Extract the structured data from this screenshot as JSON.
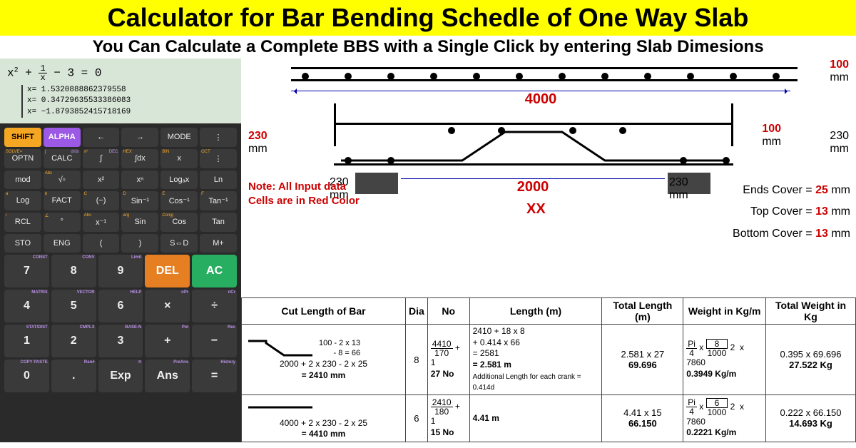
{
  "title": "Calculator for Bar Bending Schedle of One Way Slab",
  "subtitle": "You Can Calculate a Complete BBS with a Single Click by entering Slab Dimesions",
  "calculator": {
    "equation_html": "x<sup>2</sup> + <span class='frac'><span class='num'>1</span><span class='den'>x</span></span> − 3 = 0",
    "solutions": [
      "x= 1.5320888862379558",
      "x= 0.34729635533386083",
      "x= −1.8793852415718169"
    ],
    "rows": [
      [
        {
          "l": "SHIFT",
          "c": "shift"
        },
        {
          "l": "ALPHA",
          "c": "alpha"
        },
        {
          "l": "←"
        },
        {
          "l": "→"
        },
        {
          "l": "MODE"
        },
        {
          "l": "⋮"
        }
      ],
      [
        {
          "l": "OPTN",
          "sy": "SOLVE=",
          "sp": ""
        },
        {
          "l": "CALC",
          "sy": "∫",
          "sp": "d/dx"
        },
        {
          "l": "∫",
          "sy": "x³",
          "sp": "DEC"
        },
        {
          "l": "∫dx",
          "sy": "HEX"
        },
        {
          "l": "x",
          "sy": "BIN"
        },
        {
          "l": "⋮",
          "sy": "OCT"
        }
      ],
      [
        {
          "l": "mod",
          "sy": ""
        },
        {
          "l": "√▫",
          "sy": "Abs"
        },
        {
          "l": "x²",
          "sy": ""
        },
        {
          "l": "xⁿ",
          "sy": ""
        },
        {
          "l": "Logₐx",
          "sy": ""
        },
        {
          "l": "Ln",
          "sy": ""
        }
      ],
      [
        {
          "l": "Log",
          "sy": "a"
        },
        {
          "l": "FACT",
          "sy": "b"
        },
        {
          "l": "(−)",
          "sy": "C"
        },
        {
          "l": "Sin⁻¹",
          "sy": "D"
        },
        {
          "l": "Cos⁻¹",
          "sy": "E"
        },
        {
          "l": "Tan⁻¹",
          "sy": "F"
        }
      ],
      [
        {
          "l": "RCL",
          "sy": "i"
        },
        {
          "l": "°",
          "sy": "∠"
        },
        {
          "l": "x⁻¹",
          "sy": "Abs"
        },
        {
          "l": "Sin",
          "sy": "arg"
        },
        {
          "l": "Cos",
          "sy": "Conjg"
        },
        {
          "l": "Tan",
          "sy": ""
        }
      ],
      [
        {
          "l": "STO"
        },
        {
          "l": "ENG"
        },
        {
          "l": "("
        },
        {
          "l": ")"
        },
        {
          "l": "S⇔D"
        },
        {
          "l": "M+"
        }
      ]
    ],
    "sublabels_row": {
      "left": [
        "CONST",
        "MATRIX"
      ],
      "mid": [
        "CONV",
        "VECTOR"
      ],
      "r": [
        "Limit",
        "HELP"
      ]
    },
    "numpad": [
      [
        {
          "l": "7",
          "c": "big",
          "sp": "CONST"
        },
        {
          "l": "8",
          "c": "big",
          "sp": "CONV"
        },
        {
          "l": "9",
          "c": "big",
          "sp": "Limit"
        },
        {
          "l": "DEL",
          "c": "big del"
        },
        {
          "l": "AC",
          "c": "big ac"
        }
      ],
      [
        {
          "l": "4",
          "c": "big",
          "sp": "MATRIX"
        },
        {
          "l": "5",
          "c": "big",
          "sp": "VECTOR"
        },
        {
          "l": "6",
          "c": "big",
          "sp": "HELP"
        },
        {
          "l": "×",
          "c": "big",
          "sp": "nPr"
        },
        {
          "l": "÷",
          "c": "big",
          "sp": "nCr"
        }
      ],
      [
        {
          "l": "1",
          "c": "big",
          "sp": "STAT/DIST"
        },
        {
          "l": "2",
          "c": "big",
          "sp": "CMPLX"
        },
        {
          "l": "3",
          "c": "big",
          "sp": "BASE-N"
        },
        {
          "l": "+",
          "c": "big",
          "sp": "Pol"
        },
        {
          "l": "−",
          "c": "big",
          "sp": "Rec"
        }
      ],
      [
        {
          "l": "0",
          "c": "big",
          "sp": "COPY PASTE"
        },
        {
          "l": ".",
          "c": "big",
          "sp": "Ran#"
        },
        {
          "l": "Exp",
          "c": "big",
          "sp": "π"
        },
        {
          "l": "Ans",
          "c": "big",
          "sp": "PreAns"
        },
        {
          "l": "=",
          "c": "big",
          "sp": "History"
        }
      ]
    ]
  },
  "diagram": {
    "top_cover_dim": "100",
    "span_outer": "4000",
    "beam_depth_l": "230",
    "beam_depth_r": "230",
    "inner_100": "100",
    "support_w_l": "230",
    "support_w_r": "230",
    "span_inner": "2000",
    "xx": "XX",
    "note_l1": "Note: All Input data",
    "note_l2": "Cells are in Red Color",
    "ends_cover_label": "Ends Cover = ",
    "ends_cover": "25",
    "top_cover_label": "Top Cover = ",
    "top_cover": "13",
    "bottom_cover_label": "Bottom Cover = ",
    "bottom_cover": "13",
    "mm": "mm"
  },
  "table": {
    "headers": [
      "Cut Length of Bar",
      "Dia",
      "No",
      "Length (m)",
      "Total Length (m)",
      "Weight in Kg/m",
      "Total Weight in Kg"
    ],
    "rows": [
      {
        "shape_calc_top": "100 - 2 x  13",
        "shape_calc_top2": "- 8 =   66",
        "shape_calc": "2000 + 2 x  230  - 2 x  25",
        "shape_result": "=  2410  mm",
        "dia": "8",
        "no_frac_n": "4410",
        "no_frac_d": "170",
        "no_plus": "+ 1",
        "no_result": "27  No",
        "len_l1": "2410  + 18  x 8",
        "len_l2": "+  0.414   x 66",
        "len_l3": "=   2581",
        "len_l4": "=  2.581  m",
        "len_note": "Additional Length for each crank = 0.414d",
        "tot_len_calc": "2.581  x  27",
        "tot_len": "69.696",
        "wt_dia": "8",
        "wt_result": "0.3949  Kg/m",
        "tw_calc": "0.395  x  69.696",
        "tw": "27.522  Kg"
      },
      {
        "shape_calc": "4000  + 2 x  230  - 2 x 25",
        "shape_result": "=  4410  mm",
        "dia": "6",
        "no_frac_n": "2410",
        "no_frac_d": "180",
        "no_plus": "+ 1",
        "no_result": "15  No",
        "len_l4": "4.41  m",
        "tot_len_calc": "4.41  x  15",
        "tot_len": "66.150",
        "wt_dia": "6",
        "wt_result": "0.2221  Kg/m",
        "tw_calc": "0.222  x  66.150",
        "tw": "14.693  Kg"
      }
    ]
  }
}
